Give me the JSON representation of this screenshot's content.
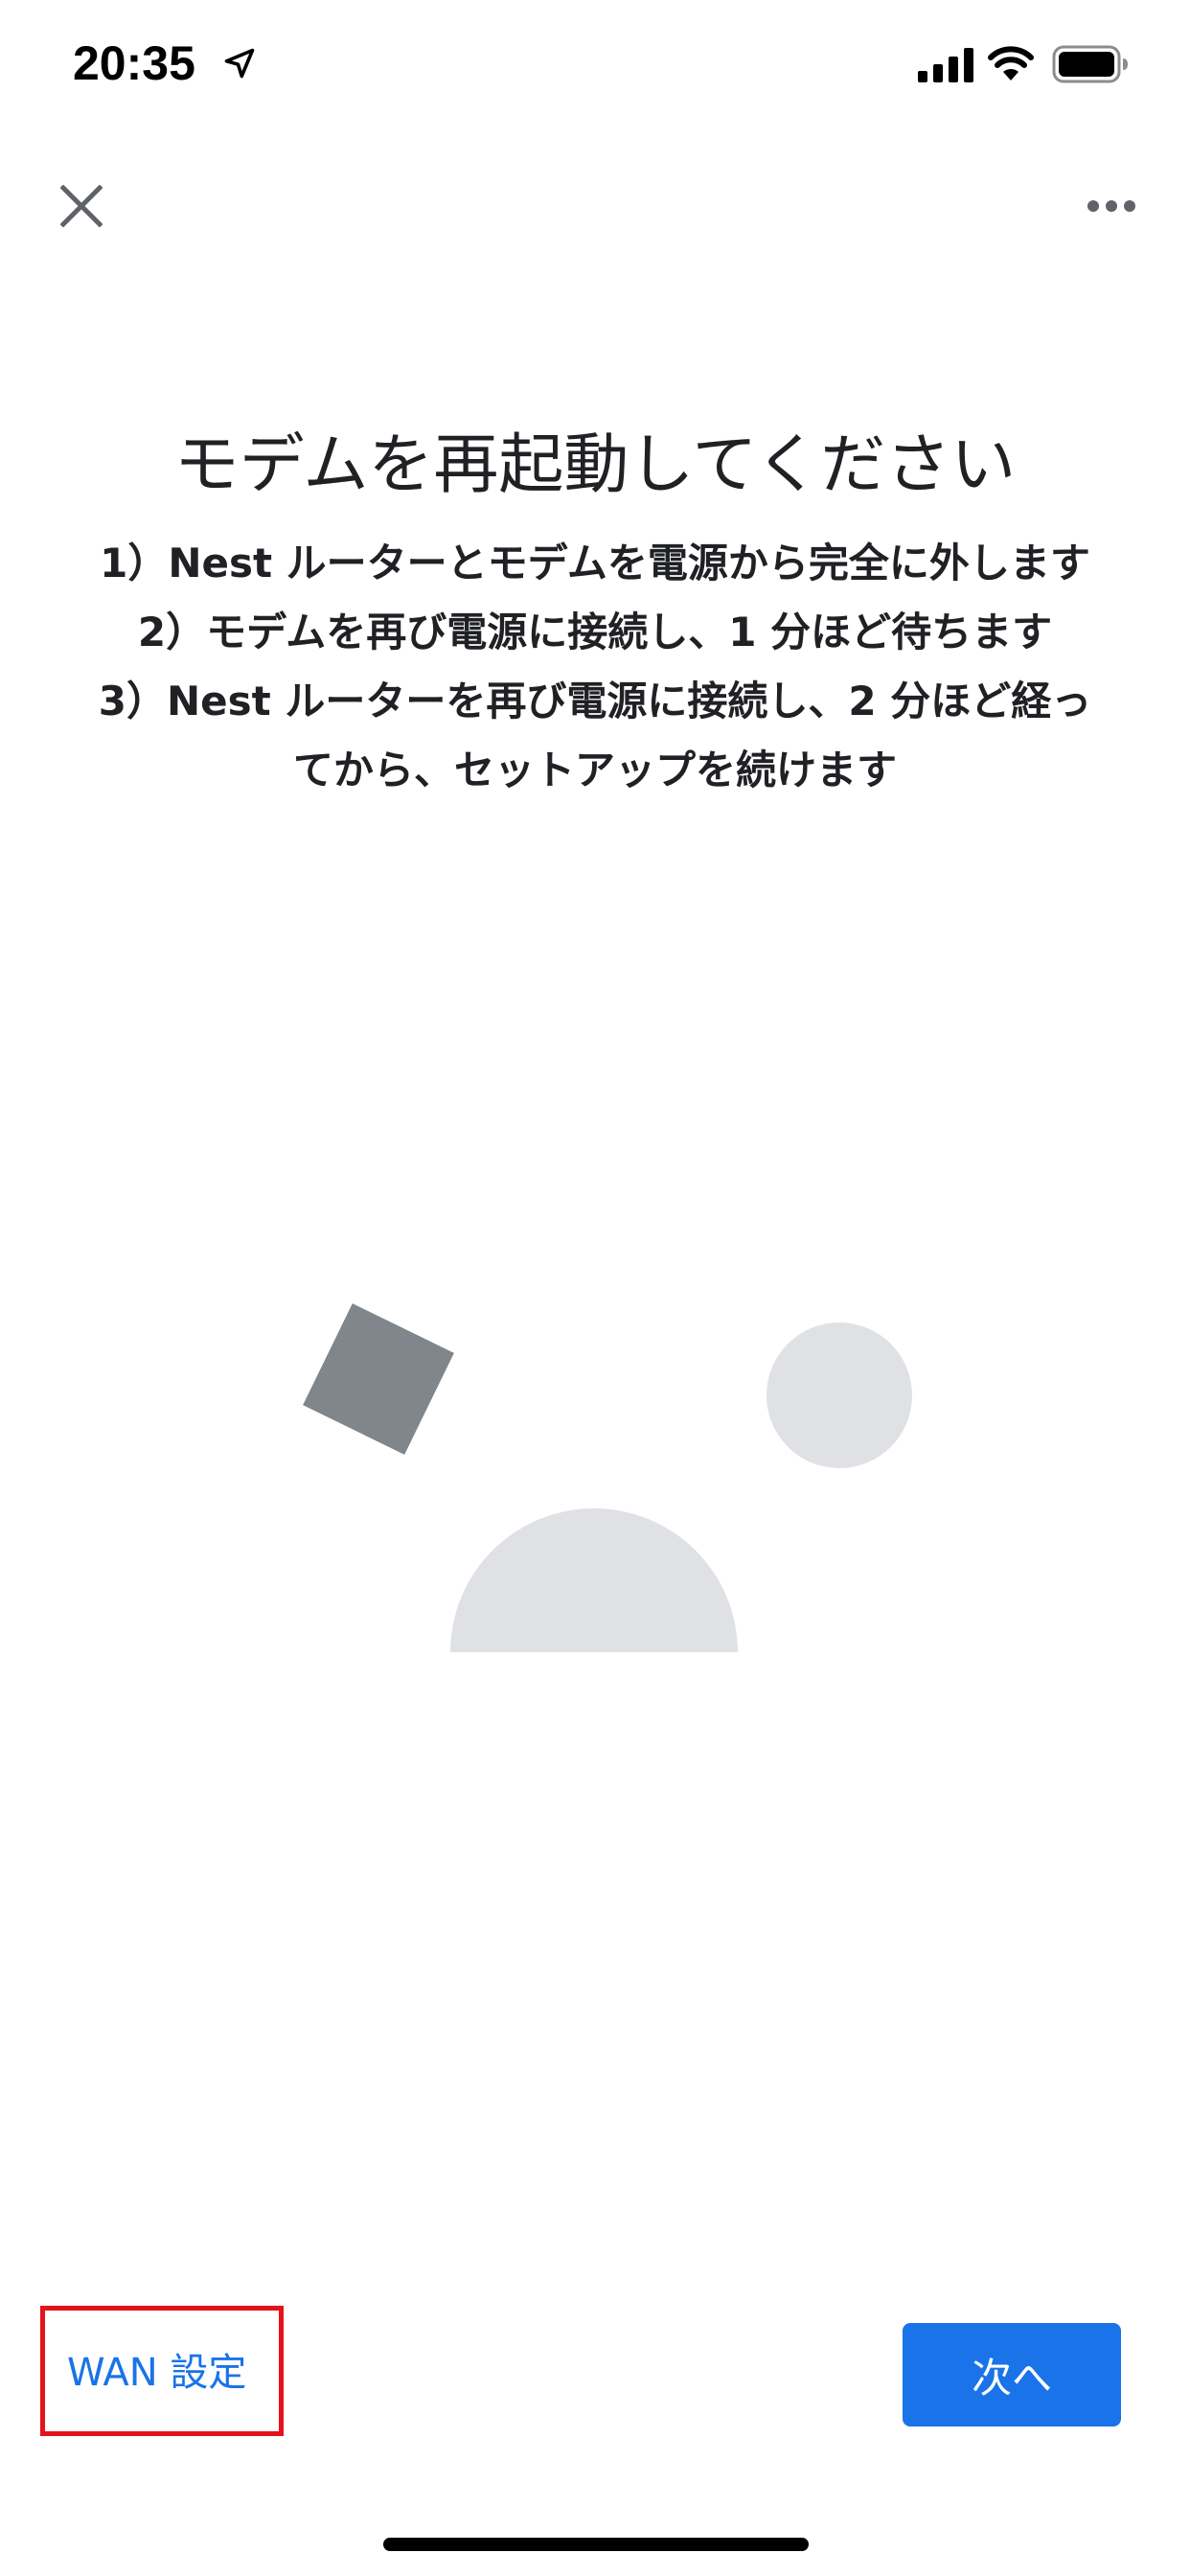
{
  "status_bar": {
    "time": "20:35",
    "icons": [
      "location-arrow-icon",
      "cellular-signal-icon",
      "wifi-icon",
      "battery-icon"
    ]
  },
  "nav": {
    "close_icon": "close-icon",
    "more_icon": "more-horizontal-icon"
  },
  "main": {
    "title": "モデムを再起動してください",
    "instructions": [
      "1）Nest ルーターとモデムを電源から完全に外します",
      "2）モデムを再び電源に接続し、1 分ほど待ちます",
      "3）Nest ルーターを再び電源に接続し、2 分ほど経っ",
      "てから、セットアップを続けます"
    ]
  },
  "illustration": {
    "shapes": [
      "gray-square",
      "light-gray-circle",
      "light-gray-semicircle"
    ],
    "colors": {
      "dark": "#80868b",
      "light": "#dfe1e5"
    }
  },
  "actions": {
    "wan_label": "WAN 設定",
    "next_label": "次へ"
  },
  "colors": {
    "accent": "#1a73e8",
    "highlight": "#e4131b",
    "text": "#202124"
  }
}
